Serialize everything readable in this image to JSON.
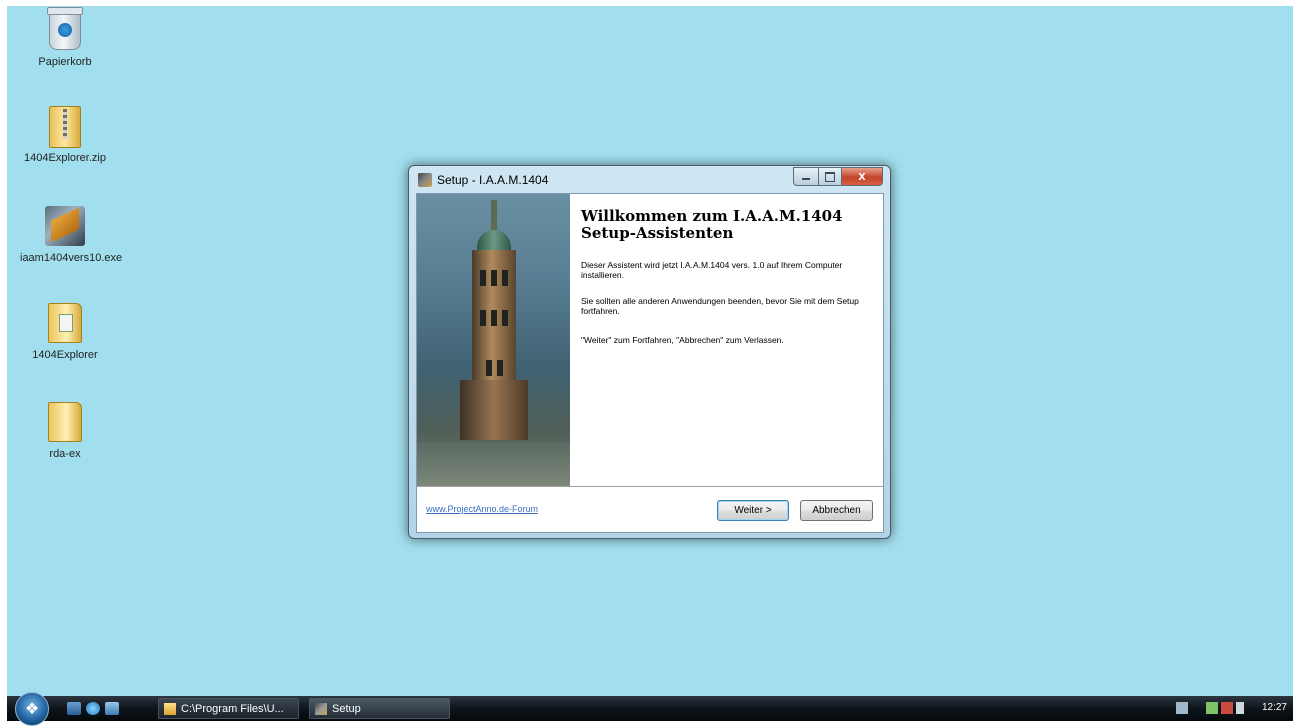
{
  "desktop": {
    "background": "#a2dfee",
    "icons": [
      {
        "label": "Papierkorb",
        "icon": "recycle-bin-icon"
      },
      {
        "label": "1404Explorer.zip",
        "icon": "zip-folder-icon"
      },
      {
        "label": "iaam1404vers10.exe",
        "icon": "setup-exe-icon"
      },
      {
        "label": "1404Explorer",
        "icon": "folder-icon"
      },
      {
        "label": "rda-ex",
        "icon": "folder-icon"
      }
    ]
  },
  "setup_window": {
    "title": "Setup - I.A.A.M.1404",
    "heading": "Willkommen zum I.A.A.M.1404 Setup-Assistenten",
    "paragraphs": [
      "Dieser Assistent wird jetzt I.A.A.M.1404 vers. 1.0 auf Ihrem Computer installieren.",
      "Sie sollten alle anderen Anwendungen beenden, bevor Sie mit dem Setup fortfahren.",
      "\"Weiter\" zum Fortfahren, \"Abbrechen\" zum Verlassen."
    ],
    "link": "www.ProjectAnno.de-Forum",
    "next_label": "Weiter >",
    "cancel_label": "Abbrechen",
    "close_glyph": "x"
  },
  "taskbar": {
    "start_glyph": "❖",
    "tasks": [
      {
        "label": "C:\\Program Files\\U..."
      },
      {
        "label": "Setup"
      }
    ],
    "clock": "12:27"
  }
}
